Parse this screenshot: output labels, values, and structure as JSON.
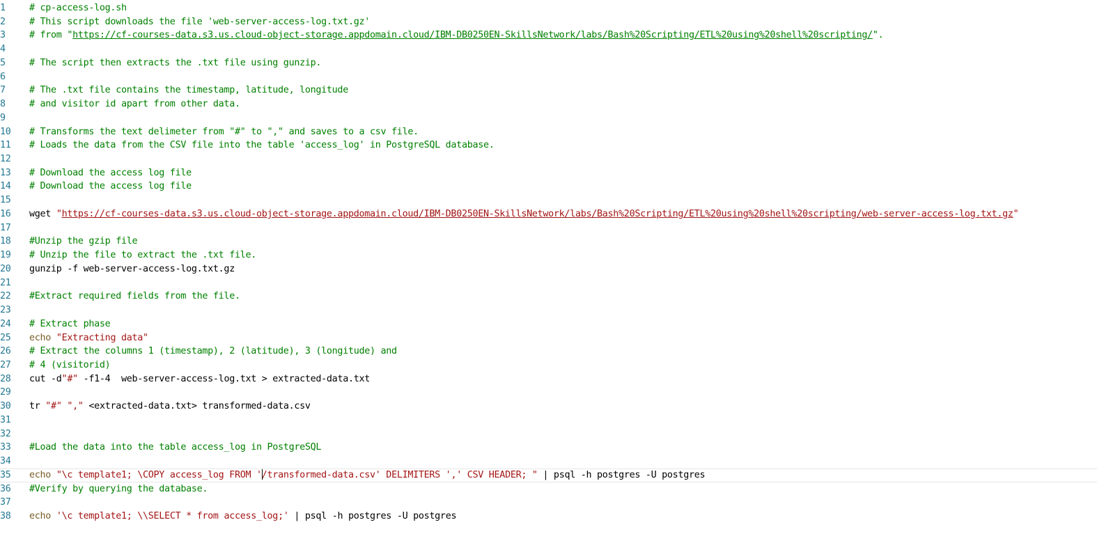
{
  "editor": {
    "file_name": "cp-access-log.sh",
    "cursor_line": 35,
    "lines": [
      {
        "n": "1",
        "segments": [
          {
            "t": "# cp-access-log.sh",
            "c": "comment"
          }
        ]
      },
      {
        "n": "2",
        "segments": [
          {
            "t": "# This script downloads the file 'web-server-access-log.txt.gz'",
            "c": "comment"
          }
        ]
      },
      {
        "n": "3",
        "segments": [
          {
            "t": "# from \"",
            "c": "comment"
          },
          {
            "t": "https://cf-courses-data.s3.us.cloud-object-storage.appdomain.cloud/IBM-DB0250EN-SkillsNetwork/labs/Bash%20Scripting/ETL%20using%20shell%20scripting/",
            "c": "link"
          },
          {
            "t": "\".",
            "c": "comment"
          }
        ]
      },
      {
        "n": "4",
        "segments": []
      },
      {
        "n": "5",
        "segments": [
          {
            "t": "# The script then extracts the .txt file using gunzip.",
            "c": "comment"
          }
        ]
      },
      {
        "n": "6",
        "segments": []
      },
      {
        "n": "7",
        "segments": [
          {
            "t": "# The .txt file contains the timestamp, latitude, longitude",
            "c": "comment"
          }
        ]
      },
      {
        "n": "8",
        "segments": [
          {
            "t": "# and visitor id apart from other data.",
            "c": "comment"
          }
        ]
      },
      {
        "n": "9",
        "segments": []
      },
      {
        "n": "10",
        "segments": [
          {
            "t": "# Transforms the text delimeter from \"#\" to \",\" and saves to a csv file.",
            "c": "comment"
          }
        ]
      },
      {
        "n": "11",
        "segments": [
          {
            "t": "# Loads the data from the CSV file into the table 'access_log' in PostgreSQL database.",
            "c": "comment"
          }
        ]
      },
      {
        "n": "12",
        "segments": []
      },
      {
        "n": "13",
        "segments": [
          {
            "t": "# Download the access log file",
            "c": "comment"
          }
        ]
      },
      {
        "n": "14",
        "segments": [
          {
            "t": "# Download the access log file",
            "c": "comment"
          }
        ]
      },
      {
        "n": "15",
        "segments": []
      },
      {
        "n": "16",
        "segments": [
          {
            "t": "wget ",
            "c": "plain"
          },
          {
            "t": "\"",
            "c": "str"
          },
          {
            "t": "https://cf-courses-data.s3.us.cloud-object-storage.appdomain.cloud/IBM-DB0250EN-SkillsNetwork/labs/Bash%20Scripting/ETL%20using%20shell%20scripting/web-server-access-log.txt.gz",
            "c": "strlink"
          },
          {
            "t": "\"",
            "c": "str"
          }
        ]
      },
      {
        "n": "17",
        "segments": []
      },
      {
        "n": "18",
        "segments": [
          {
            "t": "#Unzip the gzip file",
            "c": "comment"
          }
        ]
      },
      {
        "n": "19",
        "segments": [
          {
            "t": "# Unzip the file to extract the .txt file.",
            "c": "comment"
          }
        ]
      },
      {
        "n": "20",
        "segments": [
          {
            "t": "gunzip -f web-server-access-log.txt.gz",
            "c": "plain"
          }
        ]
      },
      {
        "n": "21",
        "segments": []
      },
      {
        "n": "22",
        "segments": [
          {
            "t": "#Extract required fields from the file.",
            "c": "comment"
          }
        ]
      },
      {
        "n": "23",
        "segments": []
      },
      {
        "n": "24",
        "segments": [
          {
            "t": "# Extract phase",
            "c": "comment"
          }
        ]
      },
      {
        "n": "25",
        "segments": [
          {
            "t": "echo",
            "c": "cmd"
          },
          {
            "t": " ",
            "c": "plain"
          },
          {
            "t": "\"Extracting data\"",
            "c": "str"
          }
        ]
      },
      {
        "n": "26",
        "segments": [
          {
            "t": "# Extract the columns 1 (timestamp), 2 (latitude), 3 (longitude) and",
            "c": "comment"
          }
        ]
      },
      {
        "n": "27",
        "segments": [
          {
            "t": "# 4 (visitorid)",
            "c": "comment"
          }
        ]
      },
      {
        "n": "28",
        "segments": [
          {
            "t": "cut -d",
            "c": "plain"
          },
          {
            "t": "\"#\"",
            "c": "str"
          },
          {
            "t": " -f1-4  web-server-access-log.txt > extracted-data.txt",
            "c": "plain"
          }
        ]
      },
      {
        "n": "29",
        "segments": []
      },
      {
        "n": "30",
        "segments": [
          {
            "t": "tr ",
            "c": "plain"
          },
          {
            "t": "\"#\"",
            "c": "str"
          },
          {
            "t": " ",
            "c": "plain"
          },
          {
            "t": "\",\"",
            "c": "str"
          },
          {
            "t": " <extracted-data.txt> transformed-data.csv",
            "c": "plain"
          }
        ]
      },
      {
        "n": "31",
        "segments": []
      },
      {
        "n": "32",
        "segments": []
      },
      {
        "n": "33",
        "segments": [
          {
            "t": "#Load the data into the table access_log in PostgreSQL",
            "c": "comment"
          }
        ]
      },
      {
        "n": "34",
        "segments": []
      },
      {
        "n": "35",
        "segments": [
          {
            "t": "echo",
            "c": "cmd"
          },
          {
            "t": " ",
            "c": "plain"
          },
          {
            "t": "\"\\c template1; \\COPY access_log FROM '",
            "c": "str"
          },
          {
            "t": "",
            "c": "cursor"
          },
          {
            "t": "/transformed-data.csv' DELIMITERS ',' CSV HEADER; \"",
            "c": "str"
          },
          {
            "t": " | psql -h postgres -U postgres",
            "c": "plain"
          }
        ]
      },
      {
        "n": "36",
        "segments": [
          {
            "t": "#Verify by querying the database.",
            "c": "comment"
          }
        ]
      },
      {
        "n": "37",
        "segments": []
      },
      {
        "n": "38",
        "segments": [
          {
            "t": "echo",
            "c": "cmd"
          },
          {
            "t": " ",
            "c": "plain"
          },
          {
            "t": "'\\c template1; \\\\SELECT * from access_log;'",
            "c": "str"
          },
          {
            "t": " | psql -h postgres -U postgres",
            "c": "plain"
          }
        ]
      }
    ]
  },
  "colors": {
    "background": "#ffffff",
    "line_number": "#237893",
    "comment": "#008000",
    "string": "#a31515",
    "command": "#795e26",
    "plain": "#000000"
  }
}
